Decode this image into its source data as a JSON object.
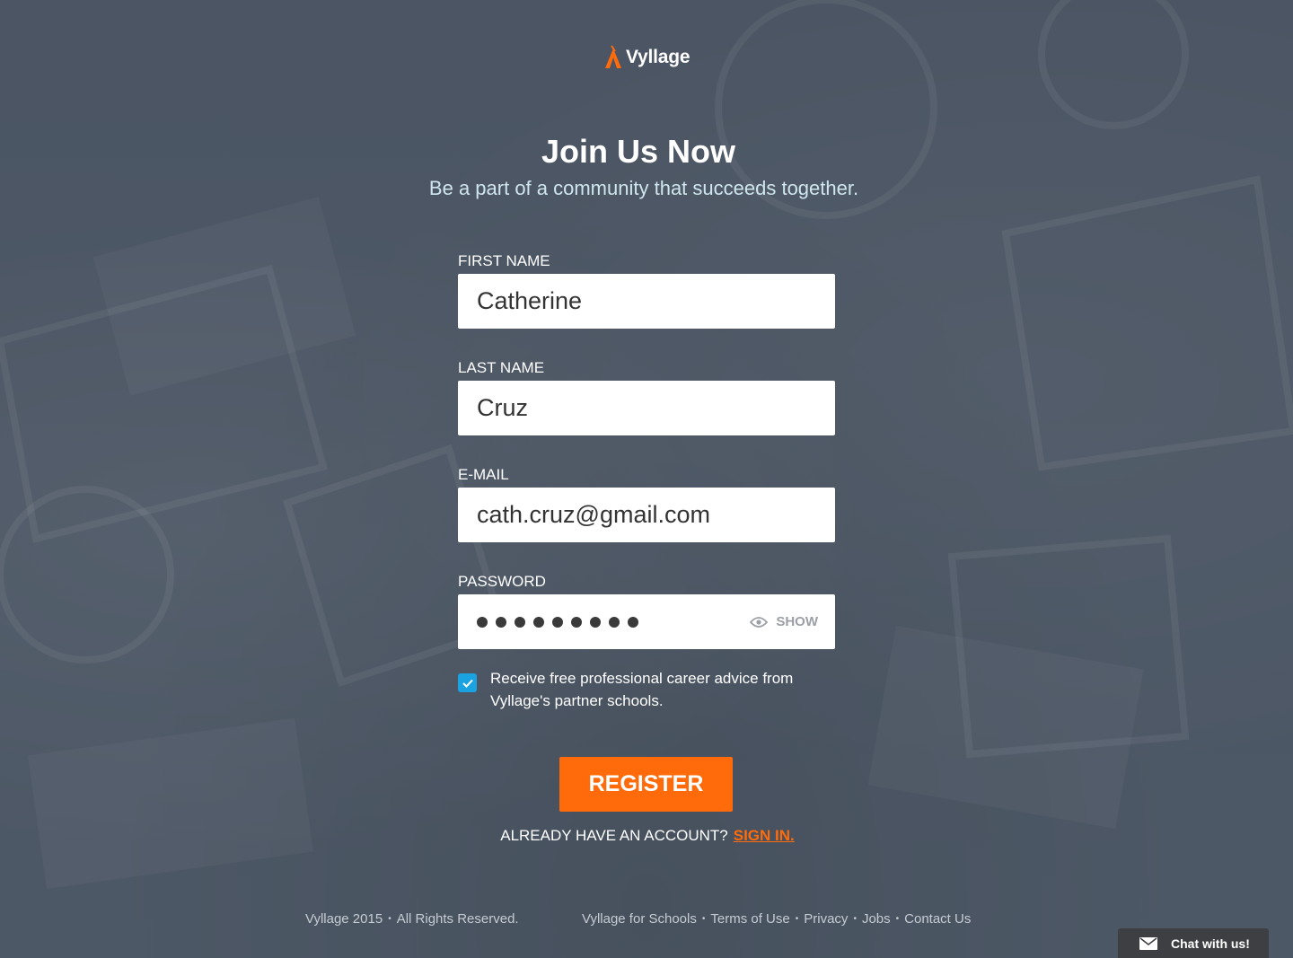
{
  "brand": {
    "name": "Vyllage",
    "accent": "#ff6b0a"
  },
  "header": {
    "title": "Join Us Now",
    "subtitle": "Be a part of a community that succeeds together."
  },
  "form": {
    "first_name": {
      "label": "FIRST NAME",
      "value": "Catherine"
    },
    "last_name": {
      "label": "LAST NAME",
      "value": "Cruz"
    },
    "email": {
      "label": "E-MAIL",
      "value": "cath.cruz@gmail.com"
    },
    "password": {
      "label": "PASSWORD",
      "masked_length": 9,
      "show_label": "SHOW",
      "icon": "eye-icon"
    },
    "career_advice": {
      "checked": true,
      "label": "Receive free professional career advice from Vyllage's partner schools."
    },
    "register_label": "REGISTER",
    "already_text": "ALREADY HAVE AN ACCOUNT?",
    "sign_in_label": "SIGN IN."
  },
  "footer": {
    "copyright": "Vyllage 2015",
    "rights": "All Rights Reserved.",
    "links": [
      "Vyllage for Schools",
      "Terms of Use",
      "Privacy",
      "Jobs",
      "Contact Us"
    ]
  },
  "chat": {
    "label": "Chat with us!",
    "icon": "mail-icon"
  },
  "colors": {
    "background": "#4a5563",
    "checkbox": "#1aa3e0",
    "chat_bg": "#3d3f43"
  }
}
